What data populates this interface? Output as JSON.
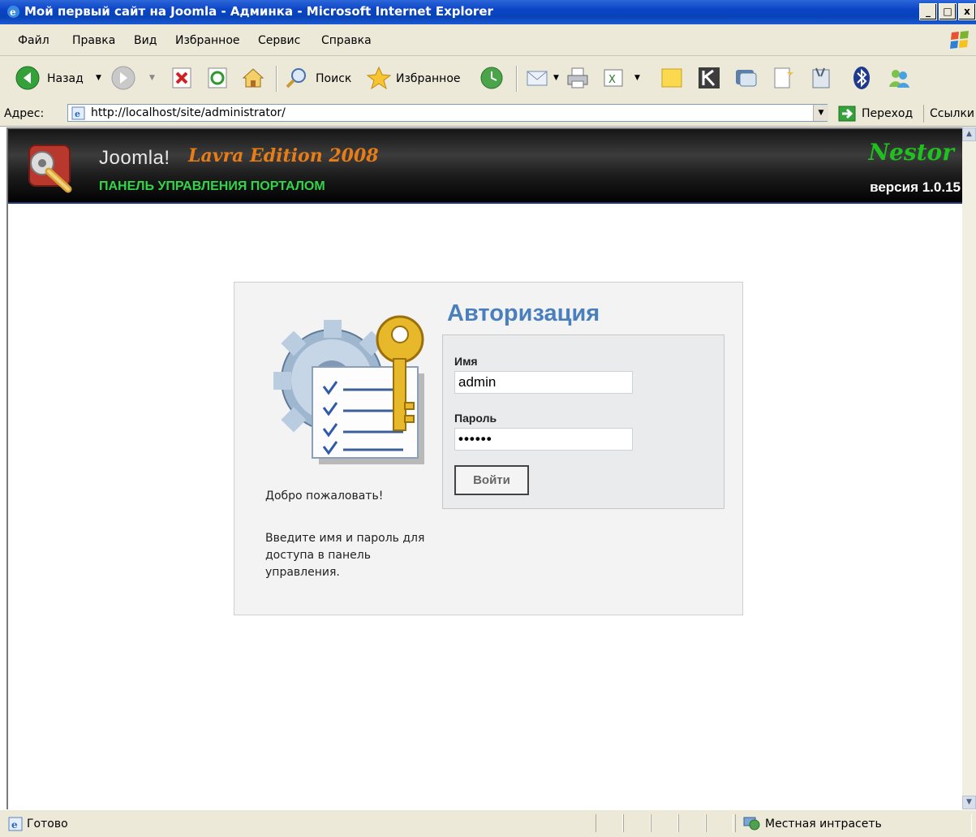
{
  "window": {
    "title": "Мой первый сайт на Joomla - Админка - Microsoft Internet Explorer",
    "minimize_label": "_",
    "maximize_label": "□",
    "close_label": "x"
  },
  "menu": {
    "items": [
      {
        "label": "Файл"
      },
      {
        "label": "Правка"
      },
      {
        "label": "Вид"
      },
      {
        "label": "Избранное"
      },
      {
        "label": "Сервис"
      },
      {
        "label": "Справка"
      }
    ]
  },
  "toolbar": {
    "back_label": "Назад",
    "search_label": "Поиск",
    "favorites_label": "Избранное"
  },
  "address": {
    "label": "Адрес:",
    "url": "http://localhost/site/administrator/",
    "go_label": "Переход",
    "links_label": "Ссылки"
  },
  "header": {
    "brand": "Joomla!",
    "edition": "Lavra Edition 2008",
    "subtitle": "ПАНЕЛЬ УПРАВЛЕНИЯ ПОРТАЛОМ",
    "nestor": "Nestor",
    "version": "версия 1.0.15"
  },
  "login": {
    "title": "Авторизация",
    "username_label": "Имя",
    "username_value": "admin",
    "password_label": "Пароль",
    "password_value": "••••••",
    "submit_label": "Войти",
    "welcome": "Добро пожаловать!",
    "instructions": "Введите имя и пароль для доступа в панель управления."
  },
  "status": {
    "text": "Готово",
    "zone": "Местная интрасеть"
  }
}
